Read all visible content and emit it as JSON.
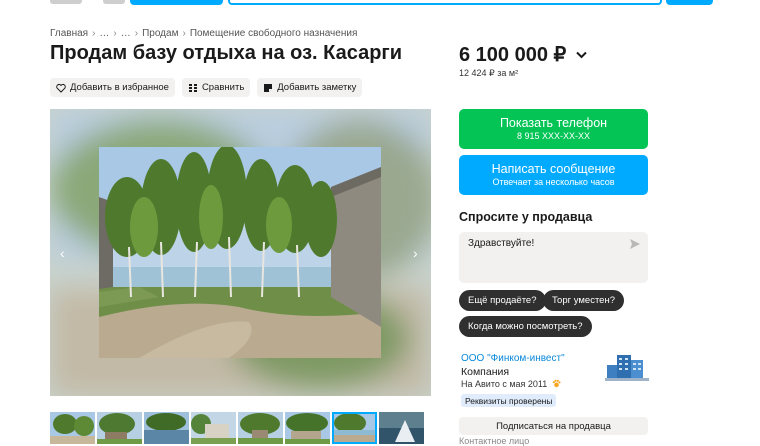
{
  "breadcrumb": {
    "items": [
      "Главная",
      "…",
      "…",
      "Продам",
      "Помещение свободного назначения"
    ],
    "separator": "›"
  },
  "listing": {
    "title": "Продам базу отдыха на оз. Касарги",
    "price": "6 100 000 ₽",
    "price_per_m2": "12 424 ₽ за м²"
  },
  "actions": {
    "favorite": "Добавить в избранное",
    "compare": "Сравнить",
    "note": "Добавить заметку"
  },
  "gallery": {
    "prev_icon": "‹",
    "next_icon": "›",
    "thumbnail_count": 8,
    "active_thumbnail": 7
  },
  "contact_buttons": {
    "phone_label": "Показать телефон",
    "phone_number": "8 915 XXX-XX-XX",
    "message_label": "Написать сообщение",
    "message_sub": "Отвечает за несколько часов"
  },
  "ask": {
    "title": "Спросите у продавца",
    "message": "Здравствуйте!",
    "chips": [
      "Ещё продаёте?",
      "Торг уместен?",
      "Когда можно посмотреть?"
    ]
  },
  "seller": {
    "name": "ООО \"Финком-инвест\"",
    "type": "Компания",
    "since": "На Авито с мая 2011",
    "verified": "Реквизиты проверены",
    "subscribe": "Подписаться на продавца",
    "contact_person": "Контактное лицо"
  },
  "colors": {
    "green": "#04c456",
    "blue": "#00aaff",
    "chip": "#2f2f2f",
    "link": "#0a88d9"
  }
}
